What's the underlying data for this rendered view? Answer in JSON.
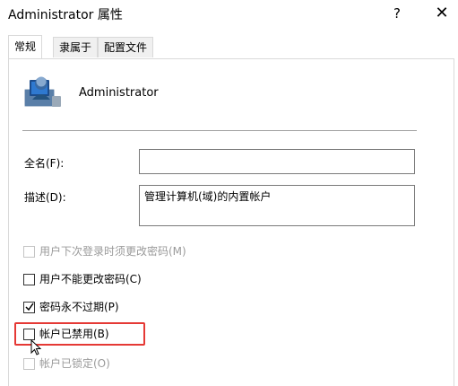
{
  "window": {
    "title": "Administrator 属性",
    "help_label": "?",
    "close_label": "✕"
  },
  "tabs": [
    {
      "label": "常规",
      "active": true
    },
    {
      "label": "隶属于",
      "active": false
    },
    {
      "label": "配置文件",
      "active": false
    }
  ],
  "user": {
    "name": "Administrator",
    "icon": "user-account-icon"
  },
  "fields": {
    "fullname_label": "全名(F):",
    "fullname_value": "",
    "description_label": "描述(D):",
    "description_value": "管理计算机(域)的内置帐户"
  },
  "checkboxes": [
    {
      "label": "用户下次登录时须更改密码(M)",
      "checked": false,
      "enabled": false
    },
    {
      "label": "用户不能更改密码(C)",
      "checked": false,
      "enabled": true
    },
    {
      "label": "密码永不过期(P)",
      "checked": true,
      "enabled": true
    },
    {
      "label": "帐户已禁用(B)",
      "checked": false,
      "enabled": true,
      "highlighted": true
    },
    {
      "label": "帐户已锁定(O)",
      "checked": false,
      "enabled": false
    }
  ],
  "colors": {
    "highlight": "#e53935",
    "border": "#7a7a7a",
    "disabled_text": "#9a9a9a"
  }
}
